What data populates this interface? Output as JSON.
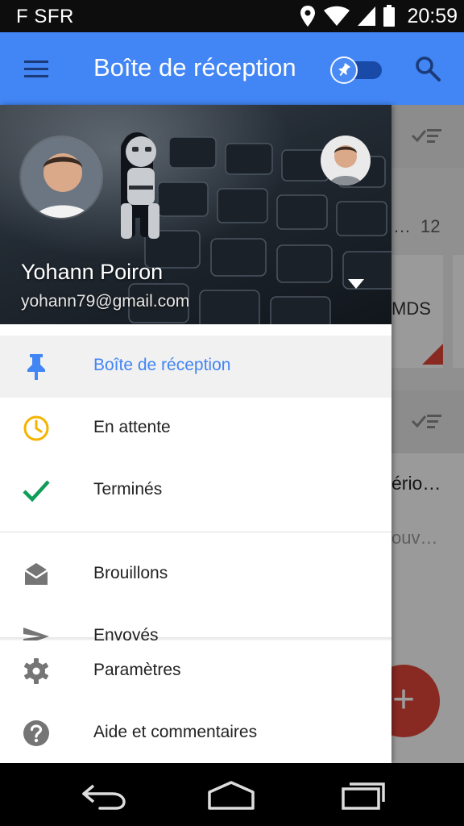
{
  "status_bar": {
    "carrier": "F SFR",
    "time": "20:59",
    "icons": [
      "location-icon",
      "wifi-icon",
      "signal-icon",
      "battery-icon"
    ]
  },
  "app_bar": {
    "title": "Boîte de réception",
    "menu_icon": "menu-icon",
    "pin_toggle_on": true,
    "search_icon": "search-icon",
    "color": "#4285f4"
  },
  "background": {
    "bundle_count": "12",
    "card1_partial": "MDS",
    "card2_title_partial": "ério…",
    "card2_snippet_partial": "ouv…",
    "count_partial": "…",
    "fab_label": "+"
  },
  "drawer": {
    "account": {
      "name": "Yohann Poiron",
      "email": "yohann79@gmail.com"
    },
    "items": [
      {
        "label": "Boîte de réception",
        "icon": "pin-icon",
        "active": true,
        "color": "#4285f4"
      },
      {
        "label": "En attente",
        "icon": "clock-icon",
        "color": "#f4b400"
      },
      {
        "label": "Terminés",
        "icon": "check-icon",
        "color": "#0f9d58"
      },
      {
        "label": "Brouillons",
        "icon": "drafts-icon"
      },
      {
        "label": "Envoyés",
        "icon": "send-icon"
      }
    ],
    "footer": [
      {
        "label": "Paramètres",
        "icon": "gear-icon"
      },
      {
        "label": "Aide et commentaires",
        "icon": "help-icon"
      }
    ]
  },
  "nav_bar": {
    "buttons": [
      "back-icon",
      "home-icon",
      "recents-icon"
    ]
  }
}
